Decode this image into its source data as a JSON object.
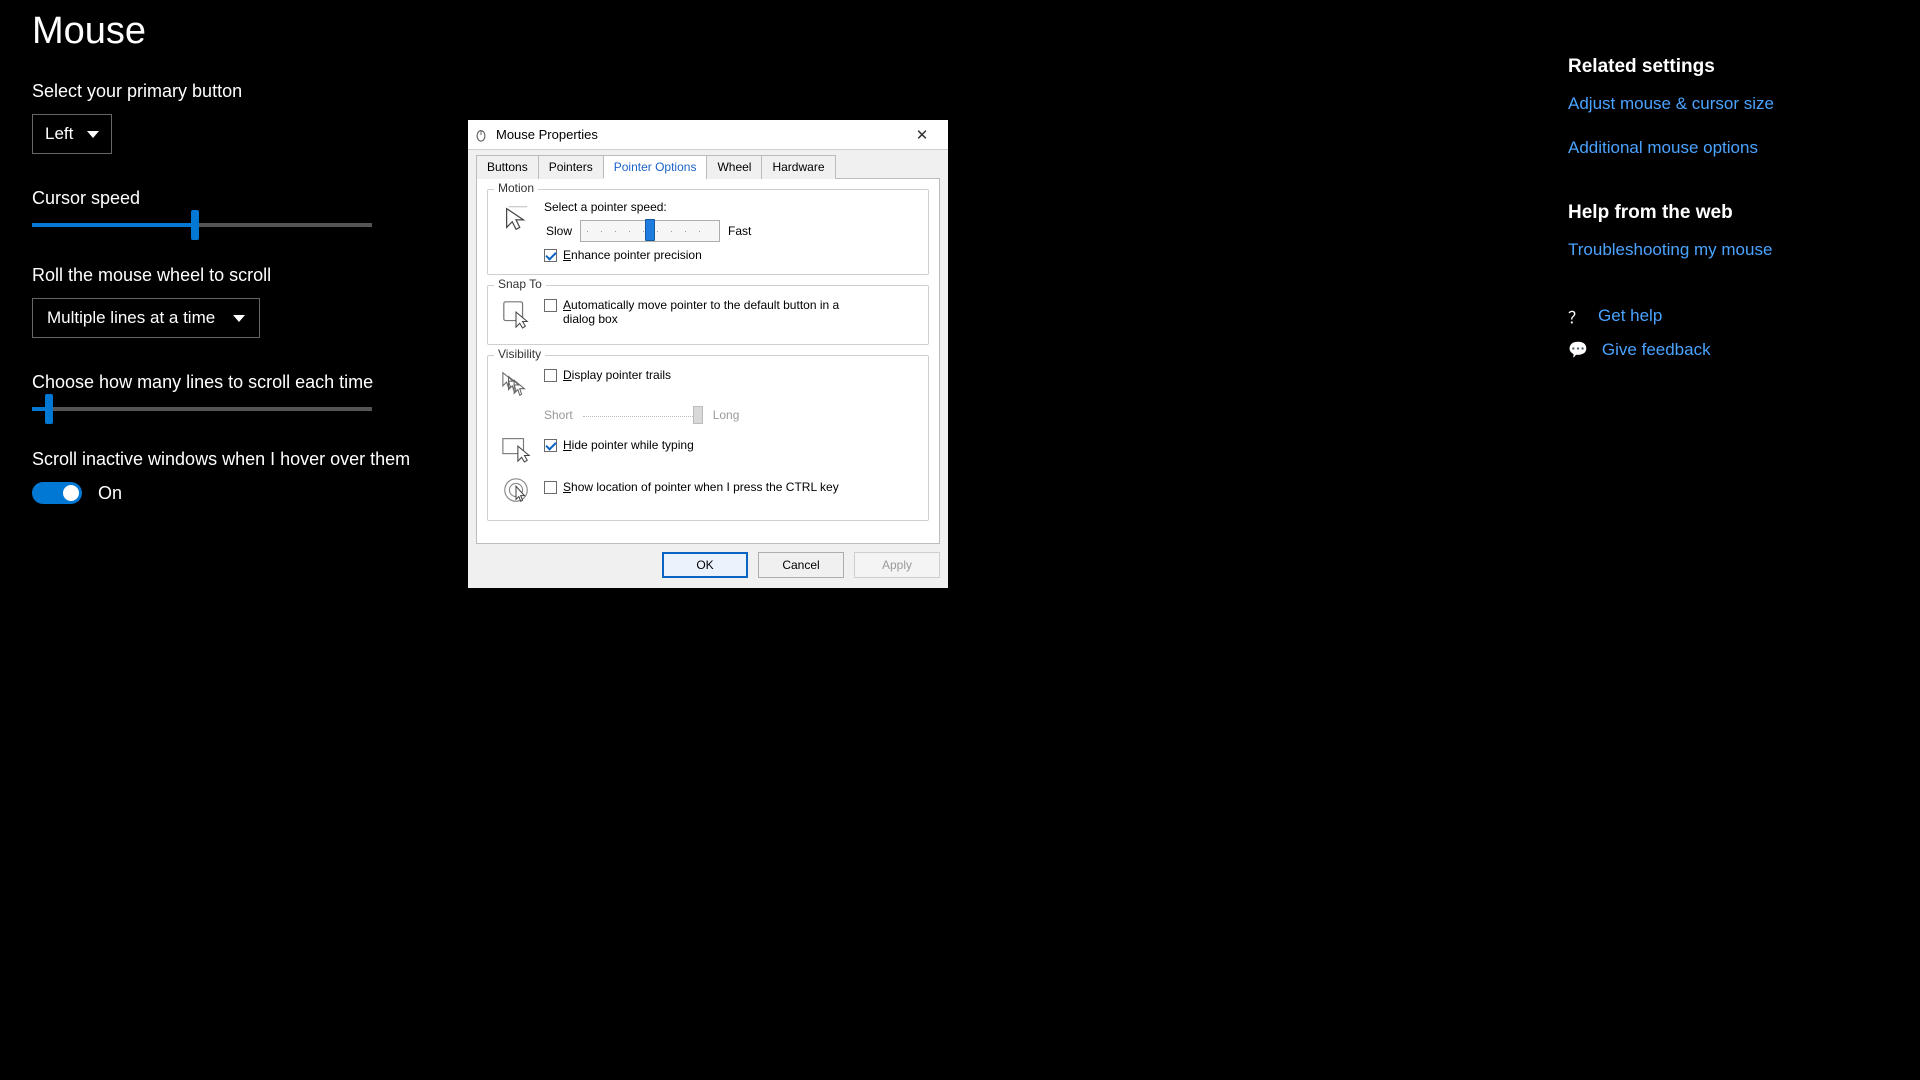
{
  "settings": {
    "title": "Mouse",
    "primary_button_heading": "Select your primary button",
    "primary_button_value": "Left",
    "cursor_speed_heading": "Cursor speed",
    "roll_wheel_heading": "Roll the mouse wheel to scroll",
    "roll_wheel_value": "Multiple lines at a time",
    "lines_each_time_heading": "Choose how many lines to scroll each time",
    "inactive_hover_heading": "Scroll inactive windows when I hover over them",
    "inactive_hover_state": "On"
  },
  "side": {
    "related_heading": "Related settings",
    "link_adjust": "Adjust mouse & cursor size",
    "link_additional": "Additional mouse options",
    "help_heading": "Help from the web",
    "link_troubleshoot": "Troubleshooting my mouse",
    "get_help": "Get help",
    "give_feedback": "Give feedback"
  },
  "dialog": {
    "title": "Mouse Properties",
    "tabs": {
      "buttons": "Buttons",
      "pointers": "Pointers",
      "pointer_options": "Pointer Options",
      "wheel": "Wheel",
      "hardware": "Hardware"
    },
    "motion": {
      "legend": "Motion",
      "select_speed": "Select a pointer speed:",
      "slow": "Slow",
      "fast": "Fast",
      "enhance_precision": "Enhance pointer precision"
    },
    "snap": {
      "legend": "Snap To",
      "auto_move": "Automatically move pointer to the default button in a dialog box"
    },
    "visibility": {
      "legend": "Visibility",
      "display_trails": "Display pointer trails",
      "short": "Short",
      "long": "Long",
      "hide_typing": "Hide pointer while typing",
      "show_ctrl": "Show location of pointer when I press the CTRL key"
    },
    "buttons_row": {
      "ok": "OK",
      "cancel": "Cancel",
      "apply": "Apply"
    }
  }
}
